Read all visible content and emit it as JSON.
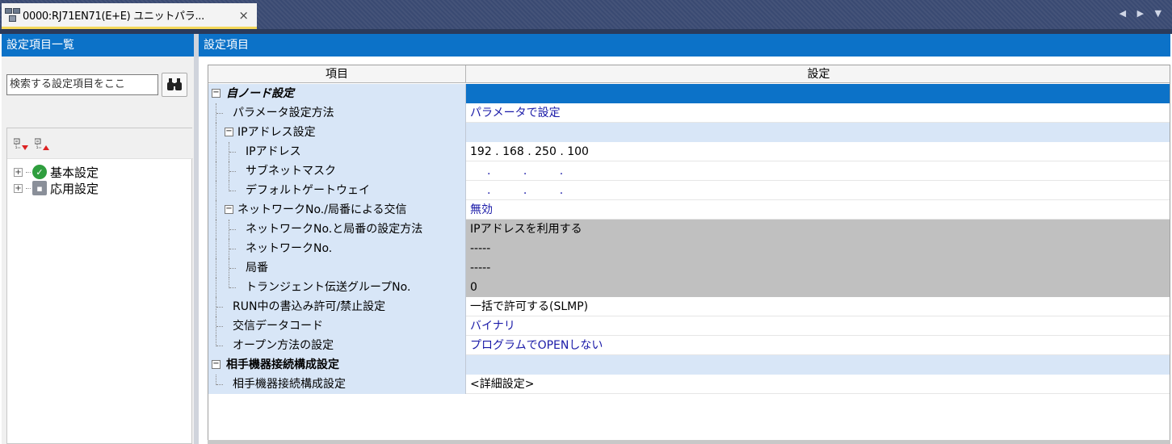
{
  "tab": {
    "title": "0000:RJ71EN71(E+E) ユニットパラ...",
    "close": "×",
    "icon": "network-module-icon"
  },
  "nav": {
    "arrows": "◀ ▶ ▼"
  },
  "left": {
    "header": "設定項目一覧",
    "search_placeholder": "検索する設定項目をここ",
    "tree": [
      {
        "label": "基本設定",
        "icon": "check-circle-icon"
      },
      {
        "label": "応用設定",
        "icon": "gear-box-icon"
      }
    ]
  },
  "right": {
    "header": "設定項目",
    "col_item": "項目",
    "col_setting": "設定"
  },
  "rows": [
    {
      "label": "自ノード設定",
      "value": ""
    },
    {
      "label": "パラメータ設定方法",
      "value": "パラメータで設定"
    },
    {
      "label": "IPアドレス設定",
      "value": ""
    },
    {
      "label": "IPアドレス",
      "value": "192 . 168 . 250 . 100"
    },
    {
      "label": "サブネットマスク",
      "value": ". . ."
    },
    {
      "label": "デフォルトゲートウェイ",
      "value": ". . ."
    },
    {
      "label": "ネットワークNo./局番による交信",
      "value": "無効"
    },
    {
      "label": "ネットワークNo.と局番の設定方法",
      "value": "IPアドレスを利用する"
    },
    {
      "label": "ネットワークNo.",
      "value": "-----"
    },
    {
      "label": "局番",
      "value": "-----"
    },
    {
      "label": "トランジェント伝送グループNo.",
      "value": "0"
    },
    {
      "label": "RUN中の書込み許可/禁止設定",
      "value": "一括で許可する(SLMP)"
    },
    {
      "label": "交信データコード",
      "value": "バイナリ"
    },
    {
      "label": "オープン方法の設定",
      "value": "プログラムでOPENしない"
    },
    {
      "label": "相手機器接続構成設定",
      "value": ""
    },
    {
      "label": "相手機器接続構成設定",
      "value": "<詳細設定>"
    }
  ]
}
